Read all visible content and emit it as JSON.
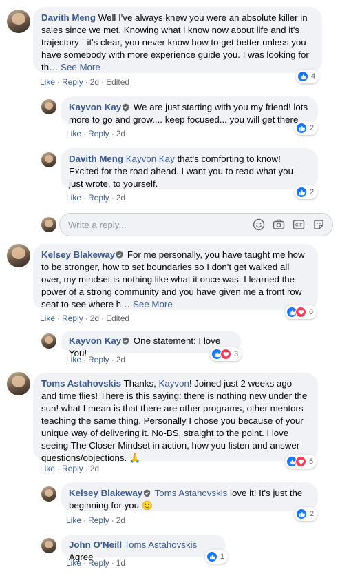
{
  "actions": {
    "like": "Like",
    "reply": "Reply",
    "edited": "Edited",
    "sep": "·"
  },
  "see_more": "See More",
  "reply_box": {
    "placeholder": "Write a reply..."
  },
  "colors": {
    "link": "#385898",
    "bubble": "#f0f2f5",
    "like": "#1877f2",
    "love": "#f33e58"
  },
  "comments": [
    {
      "author": "Davith Meng",
      "text": "Well I've always knew you were an absolute killer in sales since we met. Knowing what i know now about life and it's trajectory - it's clear, you never know how to get better unless you have somebody with more experience guide you. I was looking for th…",
      "time": "2d",
      "reactions": "4",
      "reaction_icons": [
        "like-icon"
      ]
    },
    {
      "author": "Kayvon Kay",
      "text": "We are just starting with you my friend! lots more to go and grow.... keep focused... you will get there.",
      "time": "2d",
      "reactions": "2",
      "reaction_icons": [
        "like-icon"
      ]
    },
    {
      "author": "Davith Meng",
      "mention": "Kayvon Kay",
      "text": "that's comforting to know! Excited for the road ahead. I want you to read what you just wrote, to yourself.",
      "time": "2d",
      "reactions": "2",
      "reaction_icons": [
        "like-icon"
      ]
    },
    {
      "author": "Kelsey Blakeway",
      "text": "For me personally, you have taught me how to be stronger, how to set boundaries so I don't get walked all over, my mindset is nothing like what it once was. I learned the power of a strong community and you have given me a front row seat to see where h…",
      "time": "2d",
      "reactions": "6",
      "reaction_icons": [
        "like-icon",
        "love-icon"
      ]
    },
    {
      "author": "Kayvon Kay",
      "text": "One statement: I love You!",
      "time": "2d",
      "reactions": "3",
      "reaction_icons": [
        "like-icon",
        "love-icon"
      ]
    },
    {
      "author": "Toms Astahovskis",
      "text_before": "Thanks,",
      "mention": "Kayvon",
      "text": "! Joined just 2 weeks ago and time flies! There is this saying: there is nothing new under the sun! what I mean is that there are other programs, other mentors teaching the same thing. Personally I chose you because of your unique way of delivering it. No-BS, straight to the point. I love seeing The Closer Mindset in action, how you listen and answer questions/objections.",
      "emoji": "🙏",
      "time": "2d",
      "reactions": "5",
      "reaction_icons": [
        "like-icon",
        "love-icon"
      ]
    },
    {
      "author": "Kelsey Blakeway",
      "mention": "Toms Astahovskis",
      "text": "love it! It's just the beginning for you",
      "emoji": "🙂",
      "time": "2d",
      "reactions": "2",
      "reaction_icons": [
        "like-icon"
      ]
    },
    {
      "author": "John O'Neill",
      "mention": "Toms Astahovskis",
      "text": "Agree",
      "time": "1d",
      "reactions": "1",
      "reaction_icons": [
        "like-icon"
      ]
    }
  ]
}
